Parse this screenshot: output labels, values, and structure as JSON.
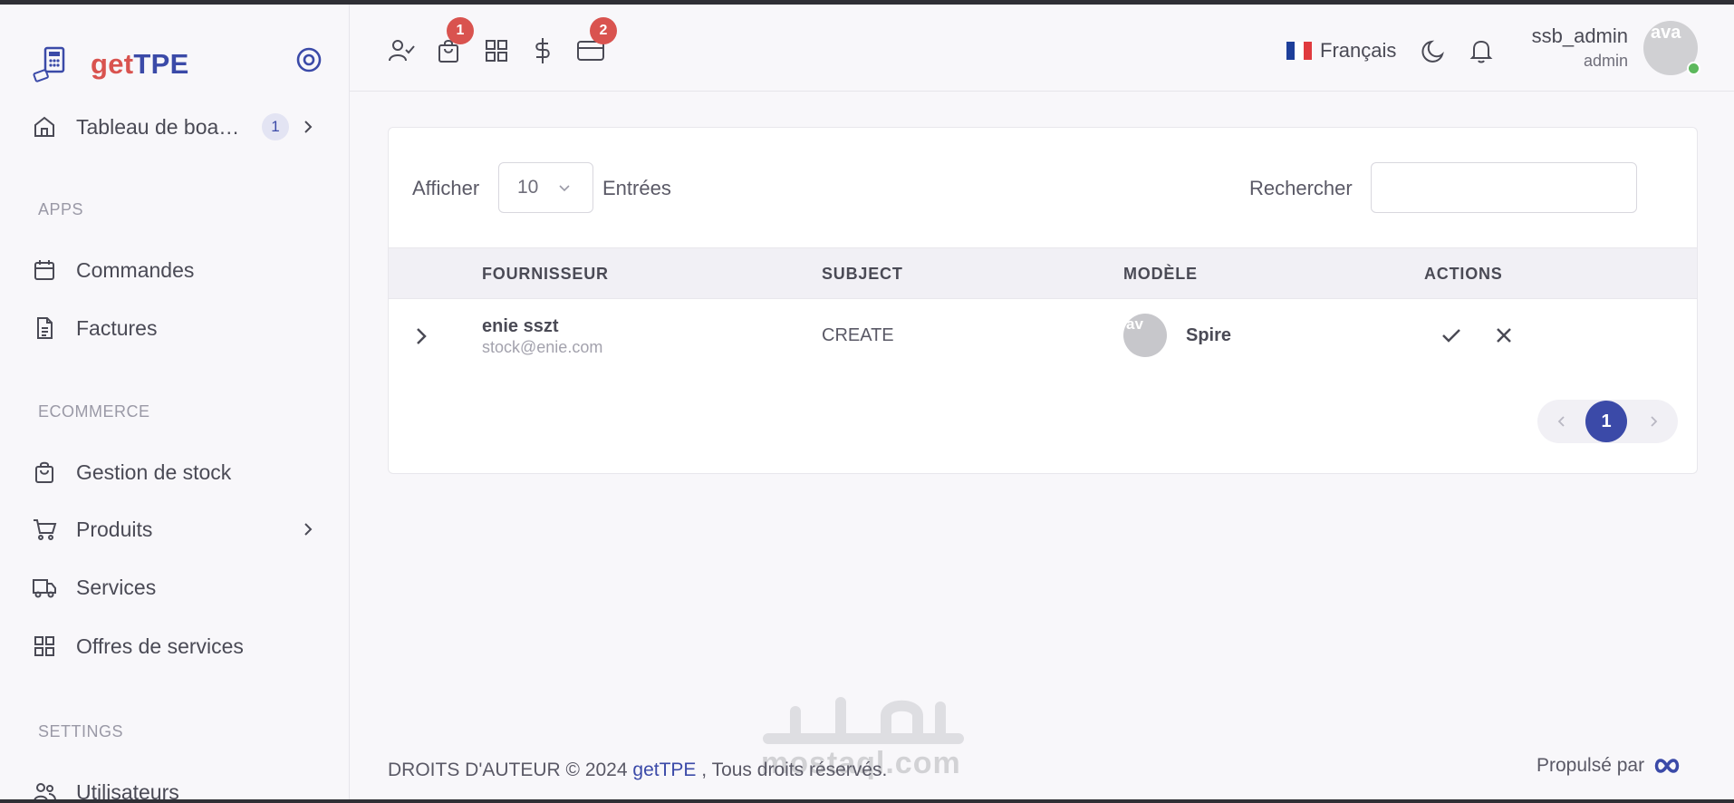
{
  "brand": {
    "get": "get",
    "tpe": "TPE"
  },
  "sidebar": {
    "dashboard": {
      "label": "Tableau de boa…",
      "badge": "1"
    },
    "sections": {
      "apps": "APPS",
      "ecommerce": "ECOMMERCE",
      "settings": "SETTINGS"
    },
    "items": [
      {
        "label": "Commandes",
        "icon": "calendar-icon"
      },
      {
        "label": "Factures",
        "icon": "file-icon"
      },
      {
        "label": "Gestion de stock",
        "icon": "shopping-bag-icon"
      },
      {
        "label": "Produits",
        "icon": "cart-icon"
      },
      {
        "label": "Services",
        "icon": "truck-icon"
      },
      {
        "label": "Offres de services",
        "icon": "grid-icon"
      },
      {
        "label": "Utilisateurs",
        "icon": "users-icon"
      }
    ]
  },
  "navbar": {
    "bag_badge": "1",
    "card_badge": "2",
    "language": "Français",
    "user_name": "ssb_admin",
    "user_role": "admin",
    "avatar_alt": "ava"
  },
  "table": {
    "show_label": "Afficher",
    "page_size": "10",
    "entries_label": "Entrées",
    "search_label": "Rechercher",
    "search_value": "",
    "columns": [
      "FOURNISSEUR",
      "SUBJECT",
      "MODÈLE",
      "ACTIONS"
    ],
    "rows": [
      {
        "supplier": "enie sszt",
        "email": "stock@enie.com",
        "subject": "CREATE",
        "model_alt": "av",
        "model": "Spire"
      }
    ],
    "current_page": "1"
  },
  "footer": {
    "copyright_prefix": "DROITS D'AUTEUR © 2024",
    "brand_link": "getTPE",
    "copyright_suffix": ", Tous droits réservés.",
    "powered_by": "Propulsé par"
  },
  "watermark": "mostaql.com",
  "colors": {
    "primary": "#3b4aa8",
    "danger": "#d9534f",
    "success": "#5cb85c"
  }
}
